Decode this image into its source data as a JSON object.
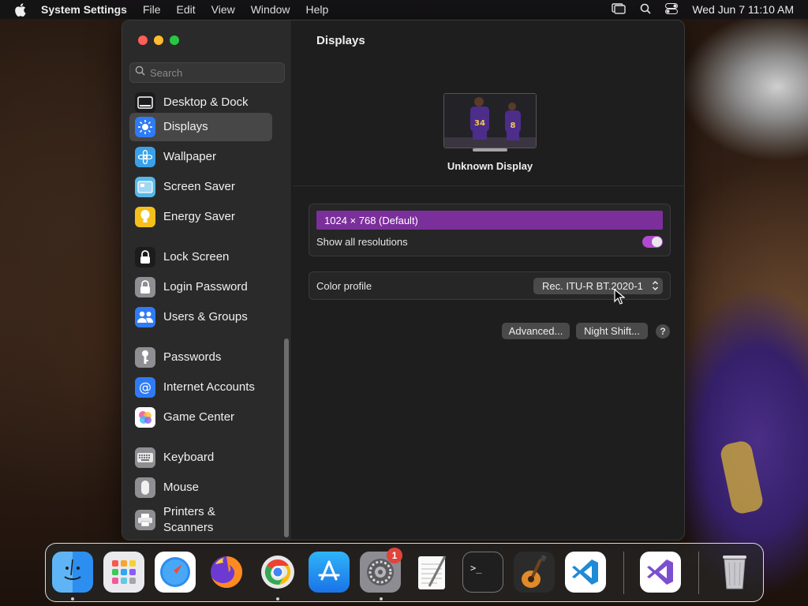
{
  "menubar": {
    "app_name": "System Settings",
    "menus": [
      "File",
      "Edit",
      "View",
      "Window",
      "Help"
    ],
    "clock": "Wed Jun 7  11:10 AM"
  },
  "sidebar": {
    "search_placeholder": "Search",
    "items": [
      {
        "label": "Desktop & Dock",
        "icon": "desktop-dock-icon",
        "color": "#1c1c1e"
      },
      {
        "label": "Displays",
        "icon": "displays-icon",
        "color": "#2f7bf6",
        "selected": true
      },
      {
        "label": "Wallpaper",
        "icon": "wallpaper-icon",
        "color": "#3aa0e8"
      },
      {
        "label": "Screen Saver",
        "icon": "screen-saver-icon",
        "color": "#57b7e8"
      },
      {
        "label": "Energy Saver",
        "icon": "energy-saver-icon",
        "color": "#f4c01c"
      },
      {
        "label": "Lock Screen",
        "icon": "lock-screen-icon",
        "color": "#1c1c1e"
      },
      {
        "label": "Login Password",
        "icon": "login-password-icon",
        "color": "#8e8e93"
      },
      {
        "label": "Users & Groups",
        "icon": "users-groups-icon",
        "color": "#2f7bf6"
      },
      {
        "label": "Passwords",
        "icon": "passwords-icon",
        "color": "#8e8e93"
      },
      {
        "label": "Internet Accounts",
        "icon": "internet-accounts-icon",
        "color": "#2f7bf6"
      },
      {
        "label": "Game Center",
        "icon": "game-center-icon",
        "color": "#ffffff"
      },
      {
        "label": "Keyboard",
        "icon": "keyboard-icon",
        "color": "#8e8e93"
      },
      {
        "label": "Mouse",
        "icon": "mouse-icon",
        "color": "#8e8e93"
      },
      {
        "label": "Printers &\nScanners",
        "icon": "printers-scanners-icon",
        "color": "#8e8e93"
      }
    ]
  },
  "main": {
    "title": "Displays",
    "display_name": "Unknown Display",
    "resolution": "1024 × 768 (Default)",
    "show_all_label": "Show all resolutions",
    "show_all_on": true,
    "color_profile_label": "Color profile",
    "color_profile_value": "Rec. ITU-R BT.2020-1",
    "advanced_label": "Advanced...",
    "night_shift_label": "Night Shift...",
    "help_label": "?"
  },
  "dock": {
    "items": [
      {
        "name": "finder-icon",
        "running": true
      },
      {
        "name": "launchpad-icon",
        "running": false
      },
      {
        "name": "safari-icon",
        "running": false
      },
      {
        "name": "firefox-icon",
        "running": false
      },
      {
        "name": "chrome-icon",
        "running": true
      },
      {
        "name": "app-store-icon",
        "running": false
      },
      {
        "name": "system-settings-icon",
        "running": true,
        "badge": "1"
      },
      {
        "name": "textedit-icon",
        "running": false
      },
      {
        "name": "terminal-icon",
        "running": false
      },
      {
        "name": "garageband-icon",
        "running": false
      },
      {
        "name": "vscode-icon",
        "running": false
      },
      {
        "name": "visual-studio-icon",
        "running": false
      },
      {
        "name": "trash-icon",
        "running": false
      }
    ]
  },
  "colors": {
    "accent_purple": "#7b2f9b",
    "toggle_on": "#b04ad0",
    "selection": "#474747"
  }
}
